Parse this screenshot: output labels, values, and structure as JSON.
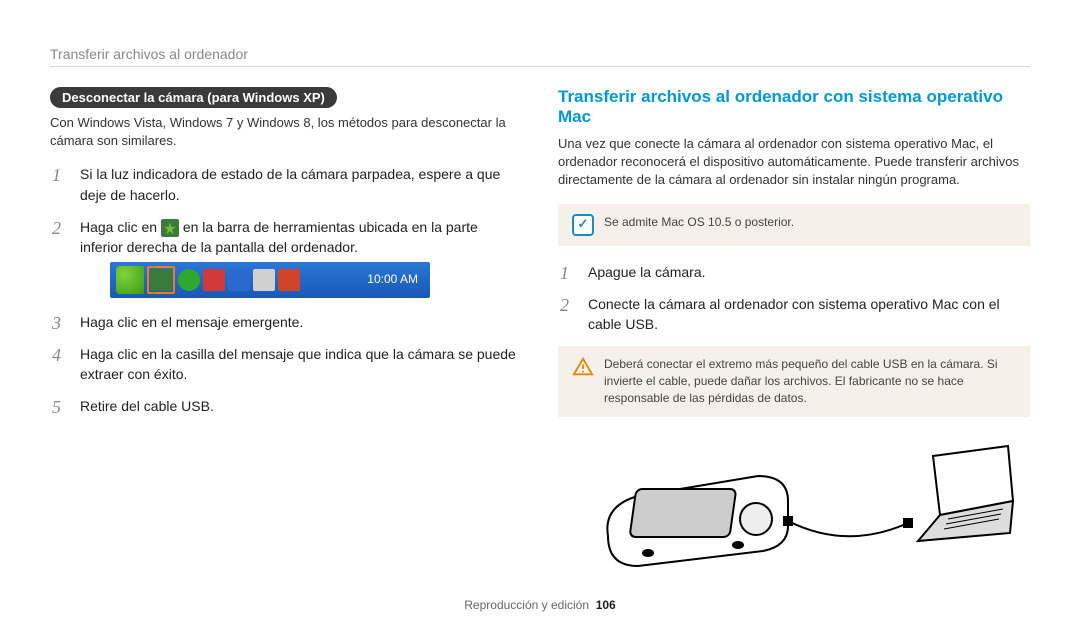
{
  "header": {
    "title": "Transferir archivos al ordenador"
  },
  "left": {
    "pill": "Desconectar la cámara (para Windows XP)",
    "intro": "Con Windows Vista, Windows 7 y Windows 8, los métodos para desconectar la cámara son similares.",
    "steps": [
      "Si la luz indicadora de estado de la cámara parpadea, espere a que deje de hacerlo.",
      {
        "pre": "Haga clic en ",
        "post": " en la barra de herramientas ubicada en la parte inferior derecha de la pantalla del ordenador."
      },
      "Haga clic en el mensaje emergente.",
      "Haga clic en la casilla del mensaje que indica que la cámara se puede extraer con éxito.",
      "Retire del cable USB."
    ],
    "taskbar": {
      "time": "10:00 AM"
    }
  },
  "right": {
    "heading": "Transferir archivos al ordenador con sistema operativo Mac",
    "intro": "Una vez que conecte la cámara al ordenador con sistema operativo Mac, el ordenador reconocerá el dispositivo automáticamente. Puede transferir archivos directamente de la cámara al ordenador sin instalar ningún programa.",
    "info_note": "Se admite Mac OS 10.5 o posterior.",
    "steps": [
      "Apague la cámara.",
      "Conecte la cámara al ordenador con sistema operativo Mac con el cable USB."
    ],
    "warning": "Deberá conectar el extremo más pequeño del cable USB en la cámara. Si invierte el cable, puede dañar los archivos. El fabricante no se hace responsable de las pérdidas de datos."
  },
  "footer": {
    "section": "Reproducción y edición",
    "page": "106"
  }
}
